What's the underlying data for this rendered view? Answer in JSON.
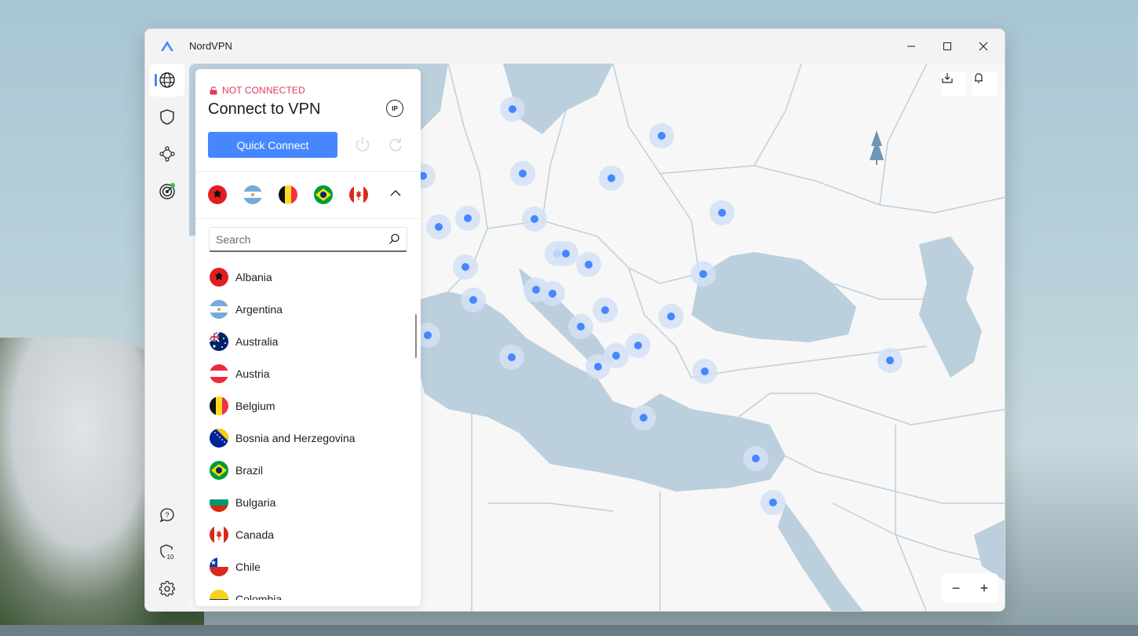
{
  "window": {
    "title": "NordVPN"
  },
  "rail": {
    "top_items": [
      {
        "name": "globe",
        "active": true
      },
      {
        "name": "shield",
        "active": false
      },
      {
        "name": "meshnet",
        "active": false
      },
      {
        "name": "dark-web-monitor",
        "active": false,
        "badge_color": "#30c05a"
      }
    ],
    "bottom_items": [
      {
        "name": "help"
      },
      {
        "name": "threat-protection",
        "badge": "10"
      },
      {
        "name": "settings"
      }
    ]
  },
  "panel": {
    "status": "NOT CONNECTED",
    "heading": "Connect to VPN",
    "ip_label": "IP",
    "quick_connect": "Quick Connect",
    "recent_flags": [
      "Albania",
      "Argentina",
      "Belgium",
      "Brazil",
      "Canada"
    ],
    "search_placeholder": "Search",
    "countries": [
      "Albania",
      "Argentina",
      "Australia",
      "Austria",
      "Belgium",
      "Bosnia and Herzegovina",
      "Brazil",
      "Bulgaria",
      "Canada",
      "Chile",
      "Colombia"
    ]
  },
  "map": {
    "zoom_out": "−",
    "zoom_in": "+"
  },
  "colors": {
    "accent": "#4687ff",
    "status_red": "#e8385a",
    "map_water": "#bccfdd",
    "map_land": "#f7f7f7",
    "server_dot": "#4687ff"
  }
}
